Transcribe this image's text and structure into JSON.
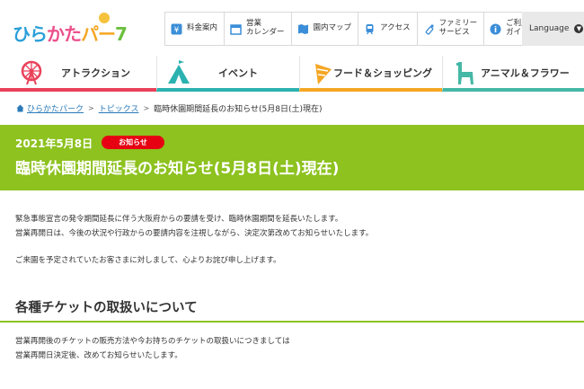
{
  "header": {
    "logo": {
      "part1": "ひら",
      "part2": "かた",
      "part3": "パー",
      "part4": "7"
    },
    "utility": [
      {
        "label1": "料金案内",
        "label2": "",
        "icon": "yen-icon",
        "color": "#3b8ed8"
      },
      {
        "label1": "営業",
        "label2": "カレンダー",
        "icon": "calendar-icon",
        "color": "#3b8ed8"
      },
      {
        "label1": "園内マップ",
        "label2": "",
        "icon": "map-icon",
        "color": "#3b8ed8"
      },
      {
        "label1": "アクセス",
        "label2": "",
        "icon": "train-icon",
        "color": "#3b8ed8"
      },
      {
        "label1": "ファミリー",
        "label2": "サービス",
        "icon": "baby-bottle-icon",
        "color": "#3b8ed8"
      },
      {
        "label1": "ご利用",
        "label2": "ガイド",
        "icon": "info-icon",
        "color": "#3b8ed8"
      }
    ],
    "language": {
      "label": "Language",
      "icon": "arrow-down-icon"
    }
  },
  "nav": [
    {
      "label": "アトラクション",
      "icon": "ferris-wheel-icon",
      "color": "#e9425a"
    },
    {
      "label": "イベント",
      "icon": "tent-icon",
      "color": "#2bb2b0"
    },
    {
      "label": "フード＆ショッピング",
      "icon": "food-icon",
      "color": "#f5a623"
    },
    {
      "label": "アニマル＆フラワー",
      "icon": "alpaca-icon",
      "color": "#45b8a6"
    }
  ],
  "breadcrumb": {
    "home": "ひらかたパーク",
    "topics": "トピックス",
    "current": "臨時休園期間延長のお知らせ(5月8日(土)現在)"
  },
  "article": {
    "date": "2021年5月8日",
    "badge": "お知らせ",
    "title": "臨時休園期間延長のお知らせ(5月8日(土)現在)",
    "para1_line1": "緊急事態宣言の発令期間延長に伴う大阪府からの要請を受け、臨時休園期間を延長いたします。",
    "para1_line2": "営業再開日は、今後の状況や行政からの要請内容を注視しながら、決定次第改めてお知らせいたします。",
    "para2": "ご来園を予定されていたお客さまに対しまして、心よりお詫び申し上げます。",
    "section_title": "各種チケットの取扱いについて",
    "para3_line1": "営業再開後のチケットの販売方法や今お持ちのチケットの取扱いにつきましては",
    "para3_line2": "営業再開日決定後、改めてお知らせいたします。"
  },
  "colors": {
    "accent_green": "#8dc21f",
    "badge_red": "#e60012",
    "link_blue": "#2a7ab8"
  }
}
